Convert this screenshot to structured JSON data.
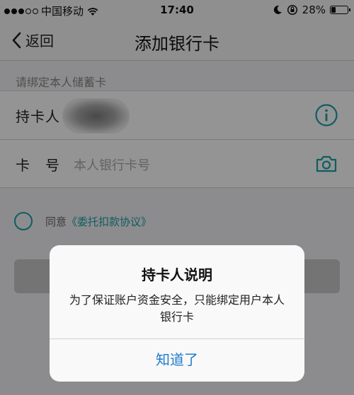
{
  "status_bar": {
    "carrier": "中国移动",
    "time": "17:40",
    "battery": "28%",
    "battery_level": 0.28,
    "signal_bars_filled": 3,
    "signal_bars_total": 5
  },
  "nav": {
    "back_label": "返回",
    "title": "添加银行卡"
  },
  "form": {
    "section_hint": "请绑定本人储蓄卡",
    "holder_label": "持卡人",
    "card_label": "卡　号",
    "card_placeholder": "本人银行卡号"
  },
  "agreement": {
    "prefix": "同意",
    "link": "《委托扣款协议》"
  },
  "dialog": {
    "title": "持卡人说明",
    "message": "为了保证账户资金安全，只能绑定用户本人银行卡",
    "button": "知道了"
  },
  "colors": {
    "accent": "#1aa0a8",
    "dialog_button": "#1f7ccc"
  },
  "icons": [
    "wifi-icon",
    "moon-icon",
    "rotation-lock-icon",
    "battery-icon",
    "back-chevron-icon",
    "info-icon",
    "camera-icon",
    "radio-icon"
  ]
}
